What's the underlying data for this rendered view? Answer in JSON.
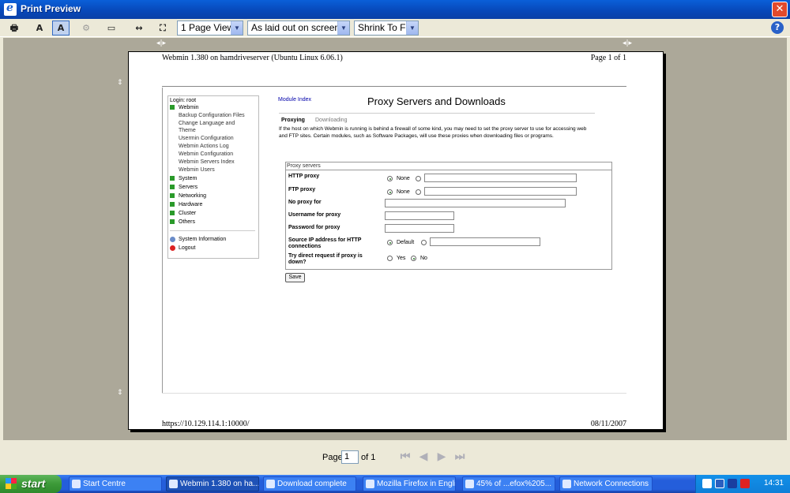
{
  "window": {
    "title": "Print Preview"
  },
  "toolbar": {
    "view_select": "1 Page View",
    "frames_select": "As laid out on screen",
    "scale_select": "Shrink To Fit"
  },
  "page": {
    "header_left": "Webmin 1.380 on hamdriveserver (Ubuntu Linux 6.06.1)",
    "header_right": "Page 1 of 1",
    "footer_left": "https://10.129.114.1:10000/",
    "footer_right": "08/11/2007"
  },
  "webmin": {
    "login": "Login: root",
    "menu": {
      "webmin": "Webmin",
      "sub": [
        "Backup Configuration Files",
        "Change Language and",
        "Theme",
        "Usermin Configuration",
        "Webmin Actions Log",
        "Webmin Configuration",
        "Webmin Servers Index",
        "Webmin Users"
      ],
      "categories": [
        "System",
        "Servers",
        "Networking",
        "Hardware",
        "Cluster",
        "Others"
      ],
      "system_info": "System Information",
      "logout": "Logout"
    },
    "module_index": "Module Index",
    "title": "Proxy Servers and Downloads",
    "tabs": [
      "Proxying",
      "Downloading"
    ],
    "intro": "If the host on which Webmin is running is behind a firewall of some kind, you may need to set the proxy server to use for accessing web and FTP sites. Certain modules, such as Software Packages, will use these proxies when downloading files or programs.",
    "box_title": "Proxy servers",
    "fields": {
      "http": "HTTP proxy",
      "ftp": "FTP proxy",
      "noproxy": "No proxy for",
      "user": "Username for proxy",
      "pass": "Password for proxy",
      "source_ip": "Source IP address for HTTP connections",
      "direct": "Try direct request if proxy is down?"
    },
    "radio": {
      "none": "None",
      "default": "Default",
      "yes": "Yes",
      "no": "No"
    },
    "save": "Save"
  },
  "pagenav": {
    "label": "Page",
    "value": "1",
    "of": "of 1"
  },
  "taskbar": {
    "start": "start",
    "tasks": [
      "Start Centre",
      "Webmin 1.380 on ha...",
      "Download complete",
      "Mozilla Firefox in Engli...",
      "45% of ...efox%205...",
      "Network Connections"
    ],
    "clock": "14:31"
  },
  "colors": {
    "titlebar": "#0a5fd8",
    "preview_bg": "#aca899",
    "taskbar": "#245edb",
    "start": "#3c9a38"
  }
}
